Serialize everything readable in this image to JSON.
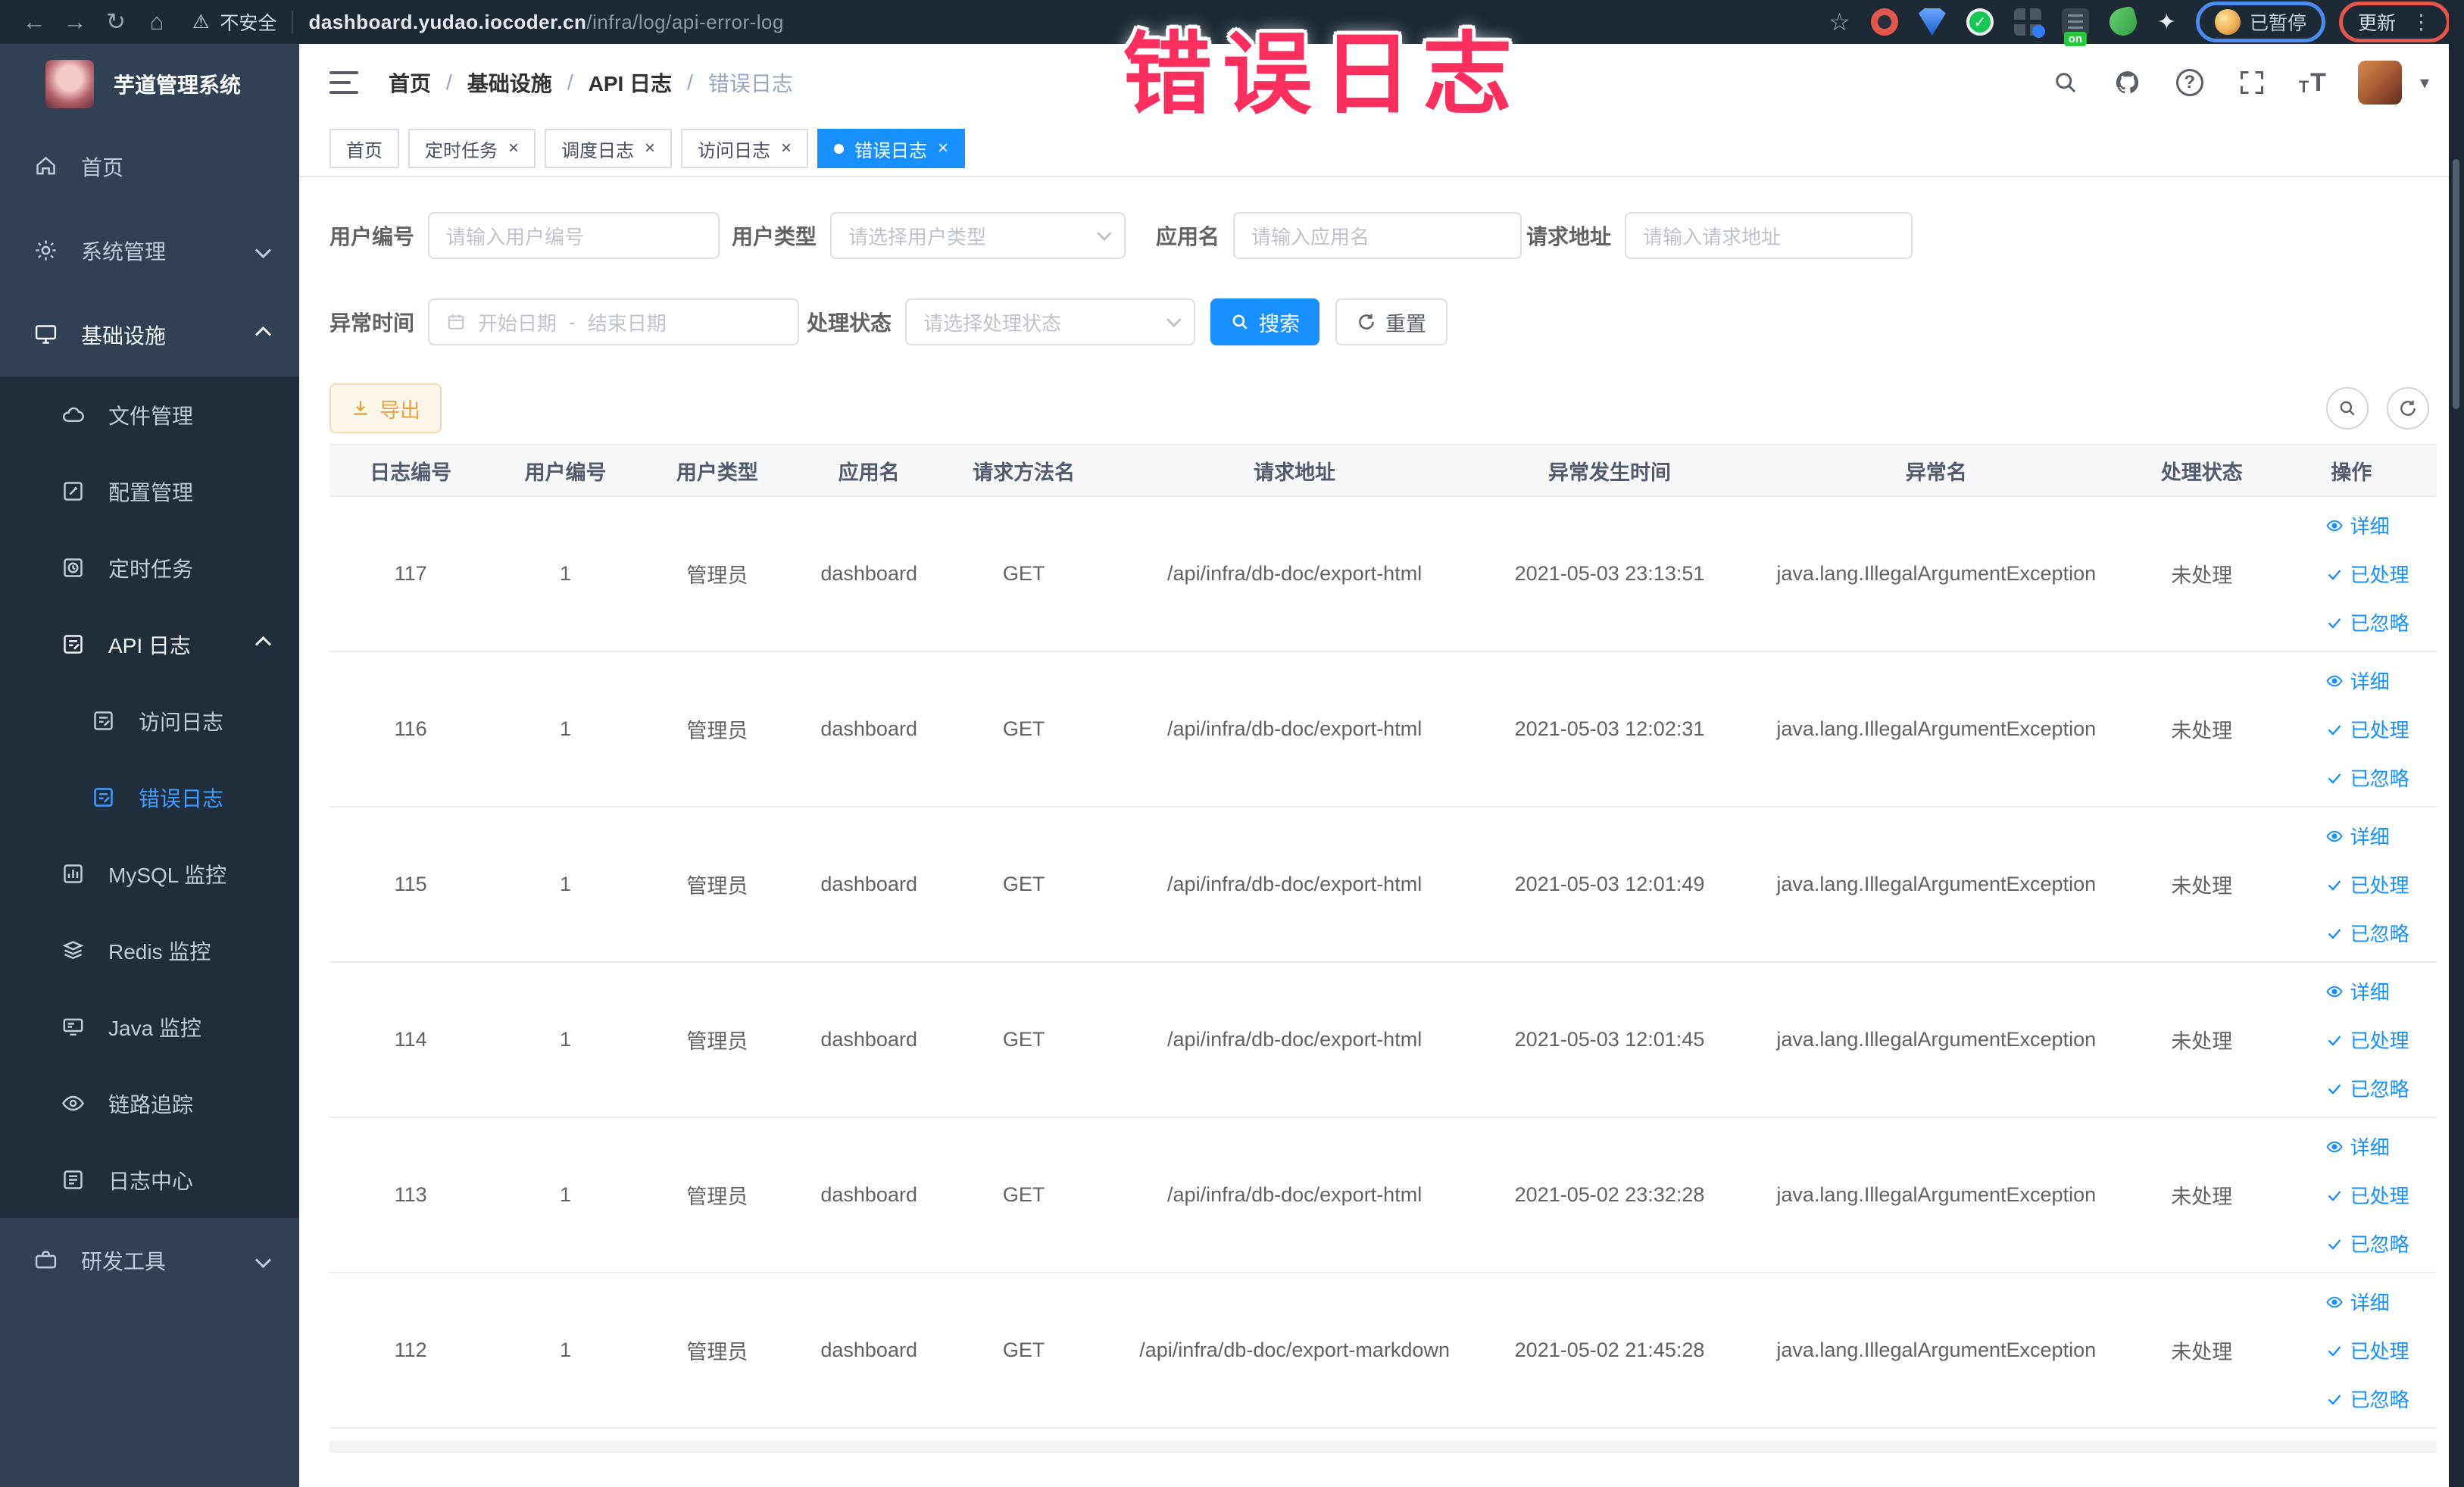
{
  "annotation": {
    "title": "错误日志",
    "color": "#fb2f5e"
  },
  "icons": {
    "back": "←",
    "forward": "→",
    "reload": "↻",
    "home": "⌂",
    "warning": "⚠",
    "bookmark_star": "☆",
    "puzzle": "✦",
    "check": "✓",
    "close": "×",
    "question_mark": "?",
    "menu_dots": "⋮",
    "caret_down": "▾",
    "font_big": "T",
    "font_small": "T"
  },
  "browser": {
    "security_label": "不安全",
    "url_domain": "dashboard.yudao.iocoder.cn",
    "url_path": "/infra/log/api-error-log",
    "extension_on_badge": "on",
    "paused_badge": "已暂停",
    "update_badge": "更新"
  },
  "sidebar": {
    "logo_title": "芋道管理系统",
    "items": {
      "home": "首页",
      "system": "系统管理",
      "infra": "基础设施",
      "file": "文件管理",
      "config": "配置管理",
      "job": "定时任务",
      "api_log": "API 日志",
      "access_log": "访问日志",
      "error_log": "错误日志",
      "mysql": "MySQL 监控",
      "redis": "Redis 监控",
      "java": "Java 监控",
      "trace": "链路追踪",
      "log_center": "日志中心",
      "tools": "研发工具"
    }
  },
  "header": {
    "breadcrumb": [
      "首页",
      "基础设施",
      "API 日志",
      "错误日志"
    ],
    "separator": "/"
  },
  "tabs": {
    "home": "首页",
    "job": "定时任务",
    "job_log": "调度日志",
    "access_log": "访问日志",
    "error_log": "错误日志"
  },
  "filters": {
    "user_id": {
      "label": "用户编号",
      "placeholder": "请输入用户编号"
    },
    "user_type": {
      "label": "用户类型",
      "placeholder": "请选择用户类型"
    },
    "app_name": {
      "label": "应用名",
      "placeholder": "请输入应用名"
    },
    "request_url": {
      "label": "请求地址",
      "placeholder": "请输入请求地址"
    },
    "exception_time": {
      "label": "异常时间",
      "start_placeholder": "开始日期",
      "separator": "-",
      "end_placeholder": "结束日期"
    },
    "process_status": {
      "label": "处理状态",
      "placeholder": "请选择处理状态"
    },
    "search_label": "搜索",
    "reset_label": "重置"
  },
  "toolbar": {
    "export_label": "导出"
  },
  "table": {
    "columns": [
      "日志编号",
      "用户编号",
      "用户类型",
      "应用名",
      "请求方法名",
      "请求地址",
      "异常发生时间",
      "异常名",
      "处理状态",
      "操作"
    ],
    "actions": {
      "detail": "详细",
      "processed": "已处理",
      "ignored": "已忽略"
    },
    "rows": [
      {
        "cells": [
          "117",
          "1",
          "管理员",
          "dashboard",
          "GET",
          "/api/infra/db-doc/export-html",
          "2021-05-03 23:13:51",
          "java.lang.IllegalArgumentException",
          "未处理"
        ]
      },
      {
        "cells": [
          "116",
          "1",
          "管理员",
          "dashboard",
          "GET",
          "/api/infra/db-doc/export-html",
          "2021-05-03 12:02:31",
          "java.lang.IllegalArgumentException",
          "未处理"
        ]
      },
      {
        "cells": [
          "115",
          "1",
          "管理员",
          "dashboard",
          "GET",
          "/api/infra/db-doc/export-html",
          "2021-05-03 12:01:49",
          "java.lang.IllegalArgumentException",
          "未处理"
        ]
      },
      {
        "cells": [
          "114",
          "1",
          "管理员",
          "dashboard",
          "GET",
          "/api/infra/db-doc/export-html",
          "2021-05-03 12:01:45",
          "java.lang.IllegalArgumentException",
          "未处理"
        ]
      },
      {
        "cells": [
          "113",
          "1",
          "管理员",
          "dashboard",
          "GET",
          "/api/infra/db-doc/export-html",
          "2021-05-02 23:32:28",
          "java.lang.IllegalArgumentException",
          "未处理"
        ]
      },
      {
        "cells": [
          "112",
          "1",
          "管理员",
          "dashboard",
          "GET",
          "/api/infra/db-doc/export-markdown",
          "2021-05-02 21:45:28",
          "java.lang.IllegalArgumentException",
          "未处理"
        ]
      }
    ]
  }
}
